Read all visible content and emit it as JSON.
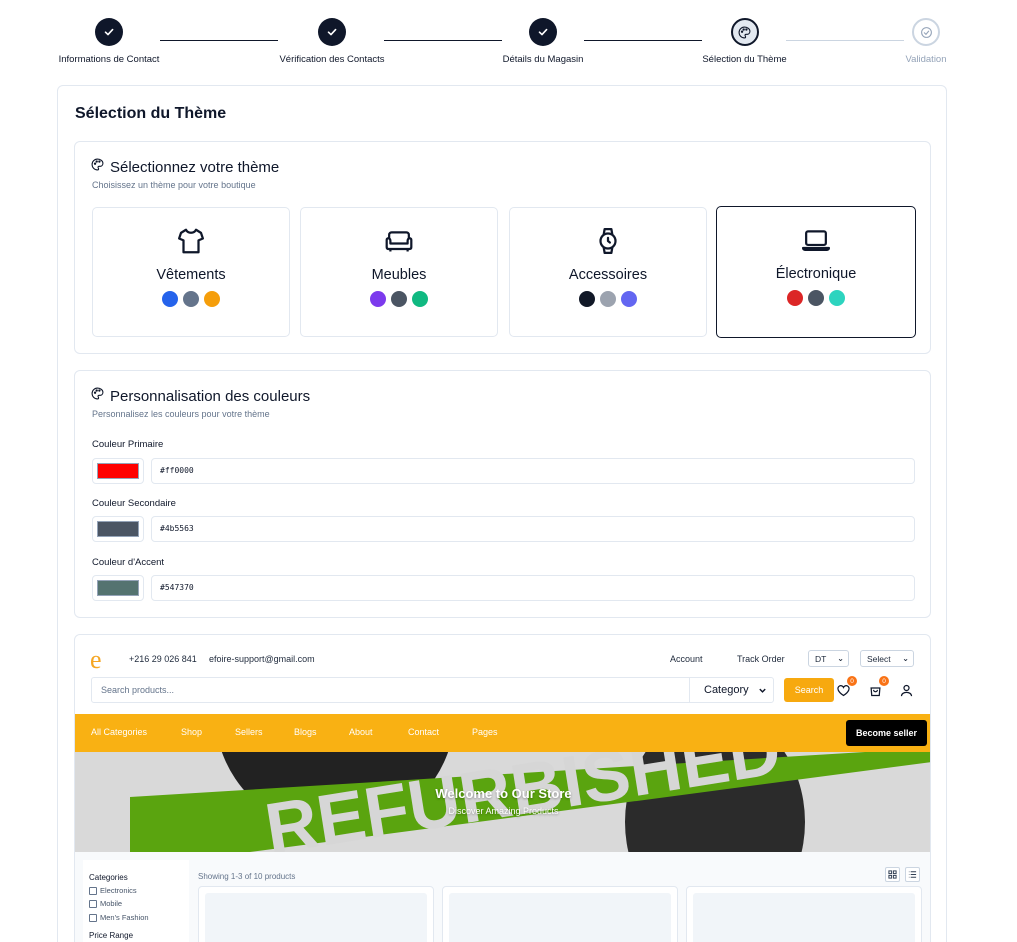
{
  "stepper": {
    "steps": [
      {
        "label": "Informations de Contact",
        "status": "done"
      },
      {
        "label": "Vérification des Contacts",
        "status": "done"
      },
      {
        "label": "Détails du Magasin",
        "status": "done"
      },
      {
        "label": "Sélection du Thème",
        "status": "current"
      },
      {
        "label": "Validation",
        "status": "pending"
      }
    ]
  },
  "main": {
    "title": "Sélection du Thème"
  },
  "theme_section": {
    "title": "Sélectionnez votre thème",
    "subtitle": "Choisissez un thème pour votre boutique",
    "themes": [
      {
        "name": "Vêtements",
        "icon": "shirt-icon",
        "colors": [
          "#2563eb",
          "#64748b",
          "#f59e0b"
        ],
        "selected": false
      },
      {
        "name": "Meubles",
        "icon": "sofa-icon",
        "colors": [
          "#7c3aed",
          "#4b5563",
          "#10b981"
        ],
        "selected": false
      },
      {
        "name": "Accessoires",
        "icon": "watch-icon",
        "colors": [
          "#111827",
          "#9ca3af",
          "#6366f1"
        ],
        "selected": false
      },
      {
        "name": "Électronique",
        "icon": "laptop-icon",
        "colors": [
          "#dc2626",
          "#4b5563",
          "#2dd4bf"
        ],
        "selected": true
      }
    ]
  },
  "colors_section": {
    "title": "Personnalisation des couleurs",
    "subtitle": "Personnalisez les couleurs pour votre thème",
    "primary": {
      "label": "Couleur Primaire",
      "value": "#ff0000",
      "color": "#ff0000"
    },
    "secondary": {
      "label": "Couleur Secondaire",
      "value": "#4b5563",
      "color": "#4b5563"
    },
    "accent": {
      "label": "Couleur d'Accent",
      "value": "#547370",
      "color": "#547370"
    }
  },
  "preview": {
    "logo": "e",
    "phone": "+216 29 026 841",
    "email": "efoire-support@gmail.com",
    "account": "Account",
    "track_order": "Track Order",
    "currency": "DT",
    "language": "Select",
    "search_placeholder": "Search products...",
    "category": "Category",
    "search_button": "Search",
    "wishlist_count": "0",
    "cart_count": "0",
    "nav": [
      "All Categories",
      "Shop",
      "Sellers",
      "Blogs",
      "About",
      "Contact",
      "Pages"
    ],
    "become_seller": "Become seller",
    "banner_text": "REFURBISHED",
    "banner_title": "Welcome to Our Store",
    "banner_subtitle": "Discover Amazing Products",
    "filters": {
      "categories_title": "Categories",
      "categories": [
        "Electronics",
        "Mobile",
        "Men's Fashion"
      ],
      "price_title": "Price Range"
    },
    "showing": "Showing 1-3 of 10 products",
    "accent_color": "#f9b113"
  }
}
